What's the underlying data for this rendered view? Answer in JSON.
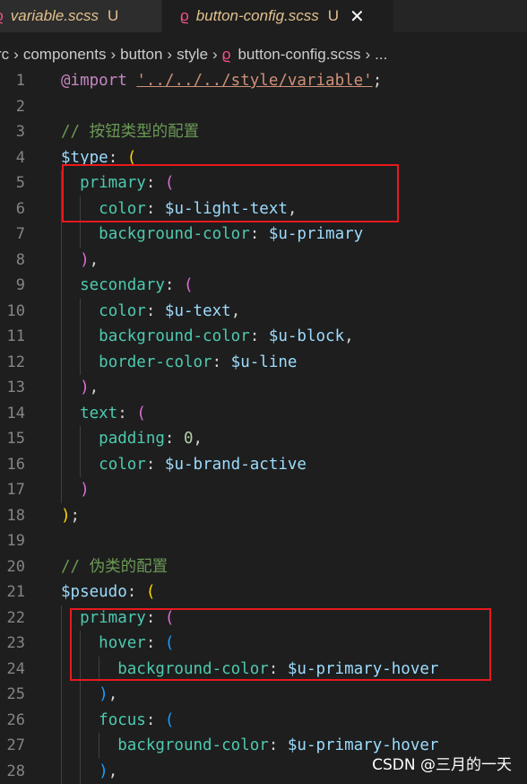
{
  "tabs": [
    {
      "label": "variable.scss",
      "status": "U",
      "active": false
    },
    {
      "label": "button-config.scss",
      "status": "U",
      "active": true,
      "close": "✕"
    }
  ],
  "breadcrumb": [
    "rc",
    "components",
    "button",
    "style",
    "button-config.scss",
    "..."
  ],
  "lines": [
    {
      "n": "1",
      "html": [
        [
          "kw",
          "@import"
        ],
        [
          "pun",
          " "
        ],
        [
          "str",
          "'../../../style/variable'"
        ],
        [
          "pun",
          ";"
        ]
      ]
    },
    {
      "n": "2",
      "html": []
    },
    {
      "n": "3",
      "html": [
        [
          "cmt",
          "// 按钮类型的配置"
        ]
      ]
    },
    {
      "n": "4",
      "html": [
        [
          "var",
          "$type"
        ],
        [
          "pun",
          ": "
        ],
        [
          "p1",
          "("
        ]
      ]
    },
    {
      "n": "5",
      "html": [
        [
          "pun",
          "  "
        ],
        [
          "prop",
          "primary"
        ],
        [
          "pun",
          ": "
        ],
        [
          "p2",
          "("
        ]
      ]
    },
    {
      "n": "6",
      "html": [
        [
          "pun",
          "    "
        ],
        [
          "prop",
          "color"
        ],
        [
          "pun",
          ": "
        ],
        [
          "var",
          "$u-light-text"
        ],
        [
          "pun",
          ","
        ]
      ]
    },
    {
      "n": "7",
      "html": [
        [
          "pun",
          "    "
        ],
        [
          "prop",
          "background-color"
        ],
        [
          "pun",
          ": "
        ],
        [
          "var",
          "$u-primary"
        ]
      ]
    },
    {
      "n": "8",
      "html": [
        [
          "pun",
          "  "
        ],
        [
          "p2",
          ")"
        ],
        [
          "pun",
          ","
        ]
      ]
    },
    {
      "n": "9",
      "html": [
        [
          "pun",
          "  "
        ],
        [
          "prop",
          "secondary"
        ],
        [
          "pun",
          ": "
        ],
        [
          "p2",
          "("
        ]
      ]
    },
    {
      "n": "10",
      "html": [
        [
          "pun",
          "    "
        ],
        [
          "prop",
          "color"
        ],
        [
          "pun",
          ": "
        ],
        [
          "var",
          "$u-text"
        ],
        [
          "pun",
          ","
        ]
      ]
    },
    {
      "n": "11",
      "html": [
        [
          "pun",
          "    "
        ],
        [
          "prop",
          "background-color"
        ],
        [
          "pun",
          ": "
        ],
        [
          "var",
          "$u-block"
        ],
        [
          "pun",
          ","
        ]
      ]
    },
    {
      "n": "12",
      "html": [
        [
          "pun",
          "    "
        ],
        [
          "prop",
          "border-color"
        ],
        [
          "pun",
          ": "
        ],
        [
          "var",
          "$u-line"
        ]
      ]
    },
    {
      "n": "13",
      "html": [
        [
          "pun",
          "  "
        ],
        [
          "p2",
          ")"
        ],
        [
          "pun",
          ","
        ]
      ]
    },
    {
      "n": "14",
      "html": [
        [
          "pun",
          "  "
        ],
        [
          "prop",
          "text"
        ],
        [
          "pun",
          ": "
        ],
        [
          "p2",
          "("
        ]
      ]
    },
    {
      "n": "15",
      "html": [
        [
          "pun",
          "    "
        ],
        [
          "prop",
          "padding"
        ],
        [
          "pun",
          ": "
        ],
        [
          "num",
          "0"
        ],
        [
          "pun",
          ","
        ]
      ]
    },
    {
      "n": "16",
      "html": [
        [
          "pun",
          "    "
        ],
        [
          "prop",
          "color"
        ],
        [
          "pun",
          ": "
        ],
        [
          "var",
          "$u-brand-active"
        ]
      ]
    },
    {
      "n": "17",
      "html": [
        [
          "pun",
          "  "
        ],
        [
          "p2",
          ")"
        ]
      ]
    },
    {
      "n": "18",
      "html": [
        [
          "p1",
          ")"
        ],
        [
          "pun",
          ";"
        ]
      ]
    },
    {
      "n": "19",
      "html": []
    },
    {
      "n": "20",
      "html": [
        [
          "cmt",
          "// 伪类的配置"
        ]
      ]
    },
    {
      "n": "21",
      "html": [
        [
          "var",
          "$pseudo"
        ],
        [
          "pun",
          ": "
        ],
        [
          "p1",
          "("
        ]
      ]
    },
    {
      "n": "22",
      "html": [
        [
          "pun",
          "  "
        ],
        [
          "prop",
          "primary"
        ],
        [
          "pun",
          ": "
        ],
        [
          "p2",
          "("
        ]
      ]
    },
    {
      "n": "23",
      "html": [
        [
          "pun",
          "    "
        ],
        [
          "prop",
          "hover"
        ],
        [
          "pun",
          ": "
        ],
        [
          "p3",
          "("
        ]
      ]
    },
    {
      "n": "24",
      "html": [
        [
          "pun",
          "      "
        ],
        [
          "prop",
          "background-color"
        ],
        [
          "pun",
          ": "
        ],
        [
          "var",
          "$u-primary-hover"
        ]
      ]
    },
    {
      "n": "25",
      "html": [
        [
          "pun",
          "    "
        ],
        [
          "p3",
          ")"
        ],
        [
          "pun",
          ","
        ]
      ]
    },
    {
      "n": "26",
      "html": [
        [
          "pun",
          "    "
        ],
        [
          "prop",
          "focus"
        ],
        [
          "pun",
          ": "
        ],
        [
          "p3",
          "("
        ]
      ]
    },
    {
      "n": "27",
      "html": [
        [
          "pun",
          "      "
        ],
        [
          "prop",
          "background-color"
        ],
        [
          "pun",
          ": "
        ],
        [
          "var",
          "$u-primary-hover"
        ]
      ]
    },
    {
      "n": "28",
      "html": [
        [
          "pun",
          "    "
        ],
        [
          "p3",
          ")"
        ],
        [
          "pun",
          ","
        ]
      ]
    }
  ],
  "watermark": "CSDN @三月的一天"
}
